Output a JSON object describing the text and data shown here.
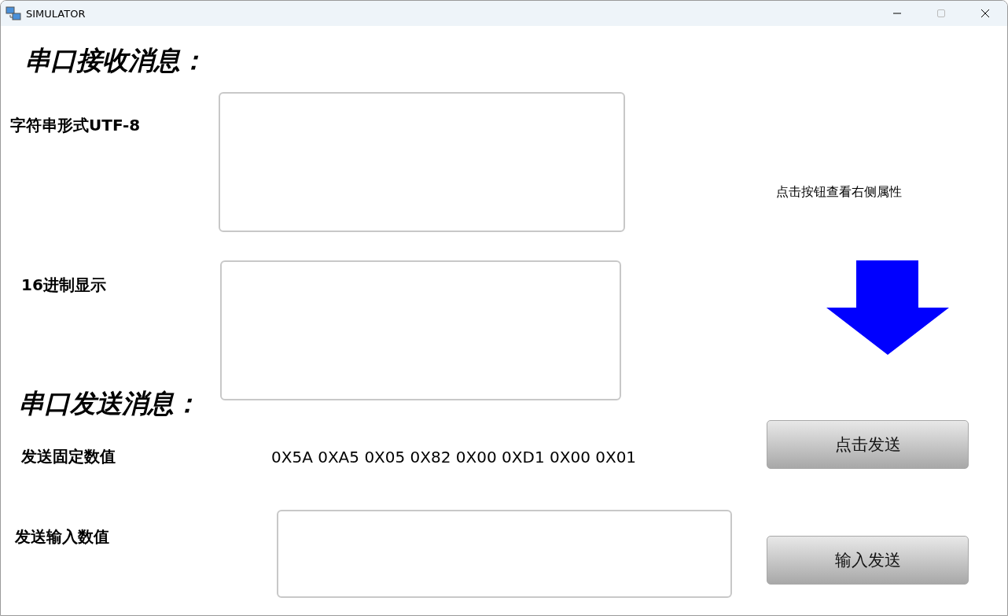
{
  "window": {
    "title": "SIMULATOR"
  },
  "receive": {
    "heading": "串口接收消息：",
    "utf8": {
      "label": "字符串形式UTF-8"
    },
    "hex": {
      "label": "16进制显示"
    }
  },
  "hint": "点击按钮查看右侧属性",
  "send": {
    "heading": "串口发送消息：",
    "fixed": {
      "label": "发送固定数值",
      "value": "0X5A 0XA5 0X05 0X82 0X00 0XD1 0X00 0X01",
      "button": "点击发送"
    },
    "input": {
      "label": "发送输入数值",
      "button": "输入发送"
    }
  }
}
